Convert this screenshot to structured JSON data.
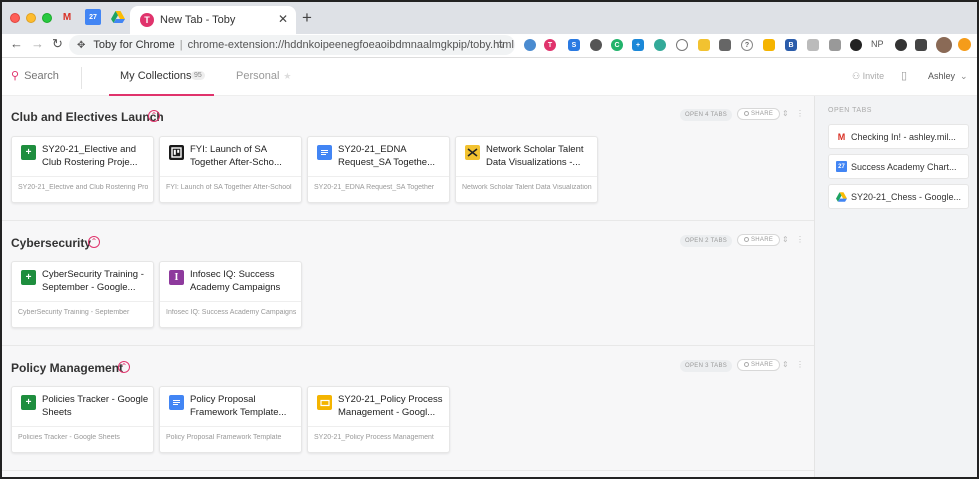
{
  "browser": {
    "active_tab_title": "New Tab - Toby",
    "close_glyph": "✕",
    "new_tab_glyph": "+",
    "site_label": "Toby for Chrome",
    "url": "chrome-extension://hddnkoipeenegfoeaoibdmnaalmgkpip/toby.html",
    "pinned_tabs": [
      "gmail-icon",
      "calendar-icon",
      "google-drive-icon"
    ],
    "extension_icons": [
      "ext-1",
      "ext-2",
      "ext-3",
      "ext-4",
      "ext-5",
      "ext-6",
      "ext-7",
      "ext-8",
      "ext-9",
      "ext-10",
      "ext-11",
      "ext-12",
      "ext-13",
      "ext-14",
      "ext-15",
      "ext-16",
      "ext-17",
      "ext-18",
      "ext-19",
      "ext-20"
    ],
    "extension_text_np": "NP"
  },
  "header": {
    "search_label": "Search",
    "my_collections_label": "My Collections",
    "my_collections_count": "95",
    "personal_label": "Personal",
    "invite_label": "Invite",
    "user_name": "Ashley"
  },
  "sections": [
    {
      "title": "Club and Electives Launch",
      "open_tabs_label": "OPEN 4 TABS",
      "share_label": "SHARE",
      "cards": [
        {
          "icon": "google-sheets-icon",
          "title": "SY20-21_Elective and Club Rostering Proje...",
          "desc": "SY20-21_Elective and Club Rostering Project"
        },
        {
          "icon": "trello-icon",
          "title": "FYI: Launch of SA Together After-Scho...",
          "desc": "FYI: Launch of SA Together After-School"
        },
        {
          "icon": "google-docs-icon",
          "title": "SY20-21_EDNA Request_SA Togethe...",
          "desc": "SY20-21_EDNA Request_SA Together"
        },
        {
          "icon": "tableau-icon",
          "title": "Network Scholar Talent Data Visualizations -...",
          "desc": "Network Scholar Talent Data Visualizations"
        }
      ]
    },
    {
      "title": "Cybersecurity",
      "open_tabs_label": "OPEN 2 TABS",
      "share_label": "SHARE",
      "cards": [
        {
          "icon": "google-sheets-icon",
          "title": "CyberSecurity Training - September - Google...",
          "desc": "CyberSecurity Training - September"
        },
        {
          "icon": "infosec-iq-icon",
          "title": "Infosec IQ: Success Academy Campaigns",
          "desc": "Infosec IQ: Success Academy Campaigns"
        }
      ]
    },
    {
      "title": "Policy Management",
      "open_tabs_label": "OPEN 3 TABS",
      "share_label": "SHARE",
      "cards": [
        {
          "icon": "google-sheets-icon",
          "title": "Policies Tracker - Google Sheets",
          "desc": "Policies Tracker - Google Sheets"
        },
        {
          "icon": "google-docs-icon",
          "title": "Policy Proposal Framework Template...",
          "desc": "Policy Proposal Framework Template"
        },
        {
          "icon": "google-slides-icon",
          "title": "SY20-21_Policy Process Management - Googl...",
          "desc": "SY20-21_Policy Process Management"
        }
      ]
    }
  ],
  "open_tabs_panel": {
    "title": "OPEN TABS",
    "tabs": [
      {
        "icon": "gmail-icon",
        "label": "Checking In! - ashley.mil..."
      },
      {
        "icon": "calendar-icon",
        "label": "Success Academy Chart..."
      },
      {
        "icon": "google-drive-icon",
        "label": "SY20-21_Chess - Google..."
      }
    ]
  },
  "colors": {
    "accent": "#e0336c",
    "sheets": "#1e8e3e",
    "docs": "#4285f4",
    "slides": "#f4b400",
    "trello": "#1a1a1a",
    "infosec": "#8e3a9d",
    "tableau": "#f2c230"
  }
}
